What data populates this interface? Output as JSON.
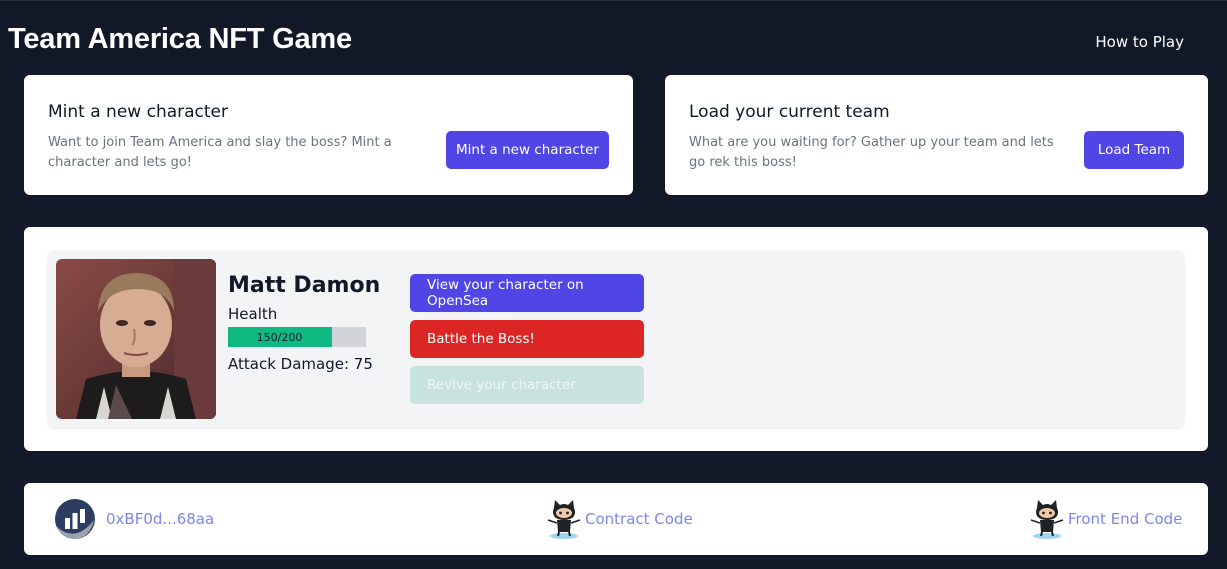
{
  "header": {
    "title": "Team America NFT Game",
    "how_to_play": "How to Play"
  },
  "mint_card": {
    "title": "Mint a new character",
    "description": "Want to join Team America and slay the boss? Mint a character and lets go!",
    "button": "Mint a new character"
  },
  "load_card": {
    "title": "Load your current team",
    "description": "What are you waiting for? Gather up your team and lets go rek this boss!",
    "button": "Load Team"
  },
  "character": {
    "name": "Matt Damon",
    "health_label": "Health",
    "hp_current": 150,
    "hp_max": 200,
    "hp_text": "150/200",
    "attack_text": "Attack Damage: 75",
    "opensea_button": "View your character on OpenSea",
    "battle_button": "Battle the Boss!",
    "revive_button": "Revive your character"
  },
  "footer": {
    "wallet": "0xBF0d...68aa",
    "contract_code": "Contract Code",
    "front_end_code": "Front End Code"
  },
  "colors": {
    "background": "#111827",
    "accent": "#4f46e5",
    "danger": "#dc2626",
    "health": "#10b981",
    "link": "#7f86e6"
  }
}
